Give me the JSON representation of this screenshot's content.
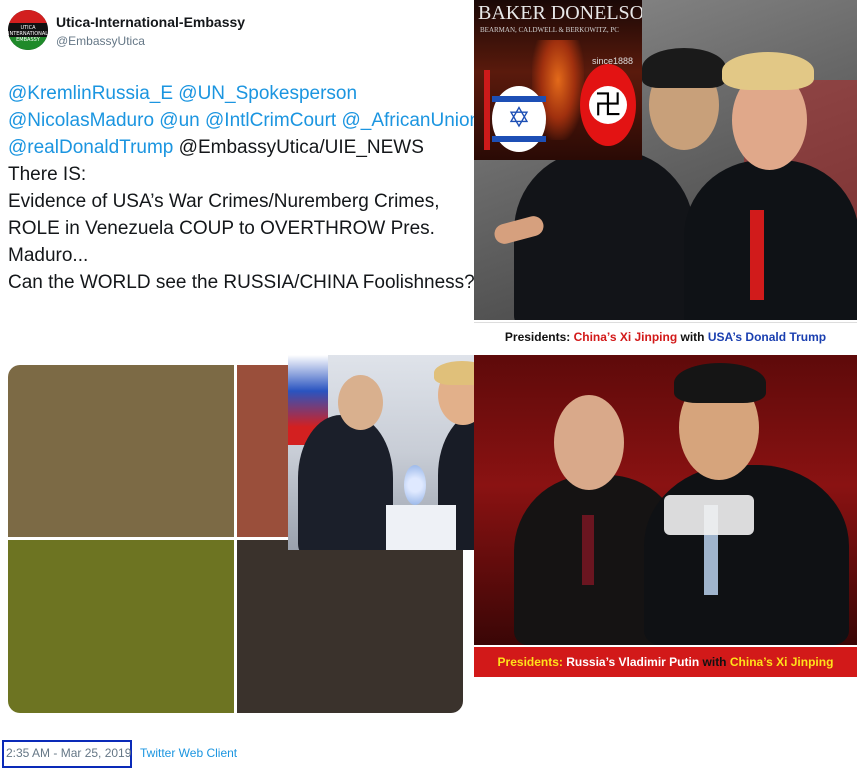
{
  "tweet": {
    "display_name": "Utica-International-Embassy",
    "handle": "@EmbassyUtica",
    "avatar_text": "UTICA INTERNATIONAL EMBASSY",
    "lines": [
      [
        {
          "text": "@KremlinRussia_E",
          "link": true
        },
        {
          "text": " ",
          "link": false
        },
        {
          "text": "@UN_Spokesperson",
          "link": true
        }
      ],
      [
        {
          "text": "@NicolasMaduro",
          "link": true
        },
        {
          "text": " ",
          "link": false
        },
        {
          "text": "@un",
          "link": true
        },
        {
          "text": " ",
          "link": false
        },
        {
          "text": "@IntlCrimCourt",
          "link": true
        },
        {
          "text": " ",
          "link": false
        },
        {
          "text": "@_AfricanUnion",
          "link": true
        }
      ],
      [
        {
          "text": "@realDonaldTrump",
          "link": true
        },
        {
          "text": " @EmbassyUtica/UIE_NEWS",
          "link": false
        }
      ],
      [
        {
          "text": "There IS:",
          "link": false
        }
      ],
      [
        {
          "text": "Evidence of USA’s War Crimes/Nuremberg Crimes,",
          "link": false
        }
      ],
      [
        {
          "text": "ROLE in Venezuela COUP to OVERTHROW Pres.",
          "link": false
        }
      ],
      [
        {
          "text": "Maduro...",
          "link": false
        }
      ],
      [
        {
          "text": "Can the WORLD see the RUSSIA/CHINA Foolishness?",
          "link": false
        }
      ]
    ],
    "timestamp": "2:35 AM - Mar 25, 2019",
    "client": "Twitter Web Client"
  },
  "colors": {
    "link": "#1b95e0",
    "grid": [
      "#7c6a45",
      "#9a4f3b",
      "#6d7422",
      "#3a322c"
    ],
    "caption_red": "#d21919",
    "highlight_box": "#0a2ab8"
  },
  "images": {
    "baker_donelson": {
      "title": "BAKER DONELSON",
      "subtitle": "BEARMAN, CALDWELL & BERKOWITZ, PC",
      "since": "since1888"
    },
    "caption_xi_trump": [
      {
        "text": "Presidents: ",
        "color": "#111111"
      },
      {
        "text": "China’s Xi Jinping",
        "color": "#d21919"
      },
      {
        "text": " with ",
        "color": "#111111"
      },
      {
        "text": "USA’s Donald Trump",
        "color": "#1a3fb0"
      }
    ],
    "caption_putin_xi": [
      {
        "text": "Presidents: ",
        "color": "#ffe11a"
      },
      {
        "text": "Russia’s Vladimir Putin",
        "color": "#ffffff"
      },
      {
        "text": " with ",
        "color": "#111111"
      },
      {
        "text": "China’s Xi Jinping",
        "color": "#ffe11a"
      }
    ]
  }
}
